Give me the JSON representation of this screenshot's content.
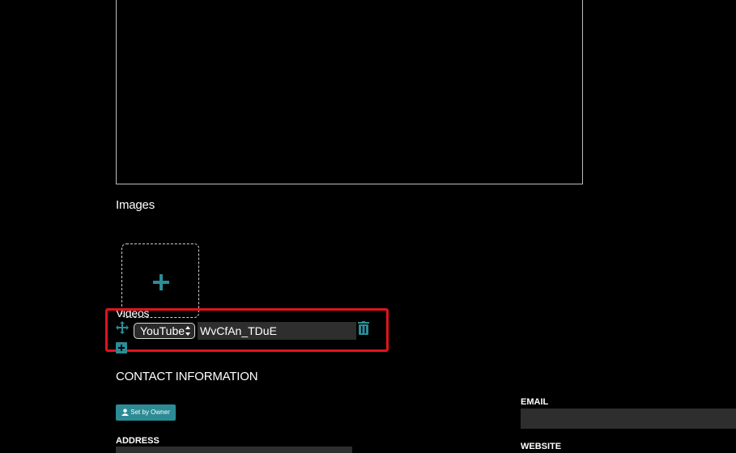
{
  "sections": {
    "images_label": "Images",
    "videos_label": "Videos",
    "contact_title": "CONTACT INFORMATION"
  },
  "video_row": {
    "provider_selected": "YouTube",
    "video_id": "WvCfAn_TDuE"
  },
  "contact": {
    "set_by_owner_label": "Set by Owner",
    "email_label": "EMAIL",
    "website_label": "WEBSITE",
    "address_label": "ADDRESS"
  },
  "colors": {
    "accent": "#2c8c96",
    "highlight": "#e0141e",
    "background": "#000000"
  },
  "icons": [
    "plus-icon",
    "move-icon",
    "trash-icon",
    "add-video-icon",
    "user-icon"
  ]
}
